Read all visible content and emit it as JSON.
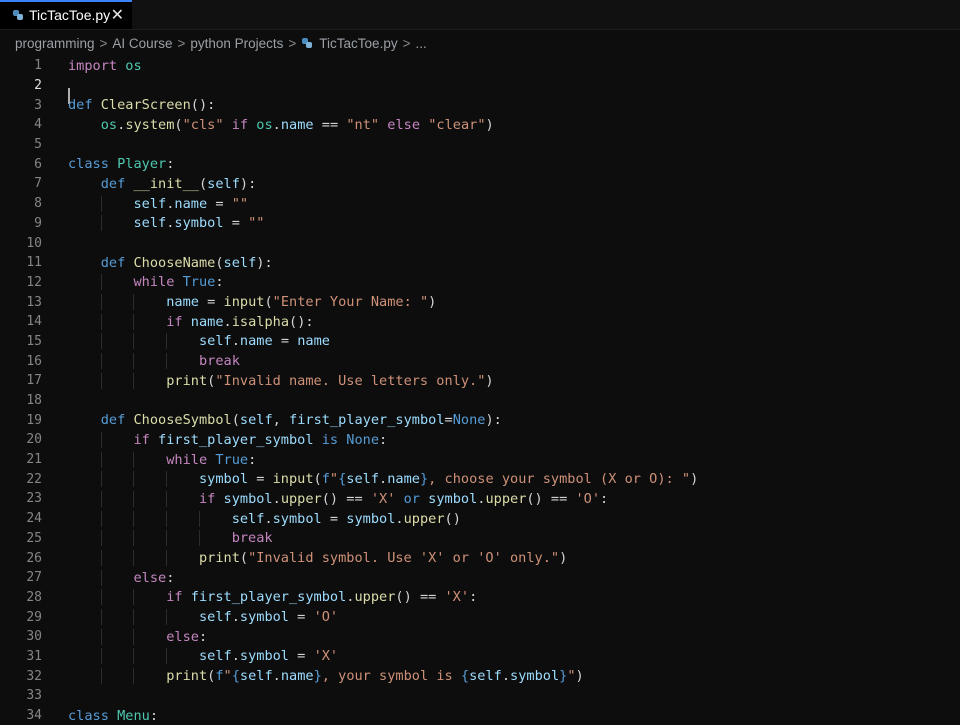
{
  "tab": {
    "filename": "TicTacToe.py",
    "close_label": "✕"
  },
  "breadcrumb": {
    "items": [
      "programming",
      "AI Course",
      "python Projects",
      "TicTacToe.py",
      "..."
    ],
    "separator": ">"
  },
  "editor": {
    "active_line": 2,
    "lines": [
      {
        "n": "1",
        "indent": 0,
        "tokens": [
          [
            "kw",
            "import"
          ],
          [
            "op",
            " "
          ],
          [
            "cls",
            "os"
          ]
        ]
      },
      {
        "n": "2",
        "indent": 0,
        "tokens": []
      },
      {
        "n": "3",
        "indent": 0,
        "tokens": [
          [
            "kwb",
            "def"
          ],
          [
            "op",
            " "
          ],
          [
            "fn",
            "ClearScreen"
          ],
          [
            "op",
            "():"
          ]
        ]
      },
      {
        "n": "4",
        "indent": 1,
        "tokens": [
          [
            "cls",
            "os"
          ],
          [
            "op",
            "."
          ],
          [
            "fn",
            "system"
          ],
          [
            "op",
            "("
          ],
          [
            "str",
            "\"cls\""
          ],
          [
            "op",
            " "
          ],
          [
            "kw",
            "if"
          ],
          [
            "op",
            " "
          ],
          [
            "cls",
            "os"
          ],
          [
            "op",
            "."
          ],
          [
            "var",
            "name"
          ],
          [
            "op",
            " == "
          ],
          [
            "str",
            "\"nt\""
          ],
          [
            "op",
            " "
          ],
          [
            "kw",
            "else"
          ],
          [
            "op",
            " "
          ],
          [
            "str",
            "\"clear\""
          ],
          [
            "op",
            ")"
          ]
        ]
      },
      {
        "n": "5",
        "indent": 0,
        "tokens": []
      },
      {
        "n": "6",
        "indent": 0,
        "tokens": [
          [
            "kwb",
            "class"
          ],
          [
            "op",
            " "
          ],
          [
            "cls",
            "Player"
          ],
          [
            "op",
            ":"
          ]
        ]
      },
      {
        "n": "7",
        "indent": 1,
        "tokens": [
          [
            "kwb",
            "def"
          ],
          [
            "op",
            " "
          ],
          [
            "fn",
            "__init__"
          ],
          [
            "op",
            "("
          ],
          [
            "var",
            "self"
          ],
          [
            "op",
            "):"
          ]
        ]
      },
      {
        "n": "8",
        "indent": 2,
        "tokens": [
          [
            "var",
            "self"
          ],
          [
            "op",
            "."
          ],
          [
            "var",
            "name"
          ],
          [
            "op",
            " = "
          ],
          [
            "str",
            "\"\""
          ]
        ]
      },
      {
        "n": "9",
        "indent": 2,
        "tokens": [
          [
            "var",
            "self"
          ],
          [
            "op",
            "."
          ],
          [
            "var",
            "symbol"
          ],
          [
            "op",
            " = "
          ],
          [
            "str",
            "\"\""
          ]
        ]
      },
      {
        "n": "10",
        "indent": 0,
        "tokens": []
      },
      {
        "n": "11",
        "indent": 1,
        "tokens": [
          [
            "kwb",
            "def"
          ],
          [
            "op",
            " "
          ],
          [
            "fn",
            "ChooseName"
          ],
          [
            "op",
            "("
          ],
          [
            "var",
            "self"
          ],
          [
            "op",
            "):"
          ]
        ]
      },
      {
        "n": "12",
        "indent": 2,
        "tokens": [
          [
            "kw",
            "while"
          ],
          [
            "op",
            " "
          ],
          [
            "kwb",
            "True"
          ],
          [
            "op",
            ":"
          ]
        ]
      },
      {
        "n": "13",
        "indent": 3,
        "tokens": [
          [
            "var",
            "name"
          ],
          [
            "op",
            " = "
          ],
          [
            "fn",
            "input"
          ],
          [
            "op",
            "("
          ],
          [
            "str",
            "\"Enter Your Name: \""
          ],
          [
            "op",
            ")"
          ]
        ]
      },
      {
        "n": "14",
        "indent": 3,
        "tokens": [
          [
            "kw",
            "if"
          ],
          [
            "op",
            " "
          ],
          [
            "var",
            "name"
          ],
          [
            "op",
            "."
          ],
          [
            "fn",
            "isalpha"
          ],
          [
            "op",
            "():"
          ]
        ]
      },
      {
        "n": "15",
        "indent": 4,
        "tokens": [
          [
            "var",
            "self"
          ],
          [
            "op",
            "."
          ],
          [
            "var",
            "name"
          ],
          [
            "op",
            " = "
          ],
          [
            "var",
            "name"
          ]
        ]
      },
      {
        "n": "16",
        "indent": 4,
        "tokens": [
          [
            "kw",
            "break"
          ]
        ]
      },
      {
        "n": "17",
        "indent": 3,
        "tokens": [
          [
            "fn",
            "print"
          ],
          [
            "op",
            "("
          ],
          [
            "str",
            "\"Invalid name. Use letters only.\""
          ],
          [
            "op",
            ")"
          ]
        ]
      },
      {
        "n": "18",
        "indent": 0,
        "tokens": []
      },
      {
        "n": "19",
        "indent": 1,
        "tokens": [
          [
            "kwb",
            "def"
          ],
          [
            "op",
            " "
          ],
          [
            "fn",
            "ChooseSymbol"
          ],
          [
            "op",
            "("
          ],
          [
            "var",
            "self"
          ],
          [
            "op",
            ", "
          ],
          [
            "var",
            "first_player_symbol"
          ],
          [
            "op",
            "="
          ],
          [
            "kwb",
            "None"
          ],
          [
            "op",
            "):"
          ]
        ]
      },
      {
        "n": "20",
        "indent": 2,
        "tokens": [
          [
            "kw",
            "if"
          ],
          [
            "op",
            " "
          ],
          [
            "var",
            "first_player_symbol"
          ],
          [
            "op",
            " "
          ],
          [
            "kwb",
            "is"
          ],
          [
            "op",
            " "
          ],
          [
            "kwb",
            "None"
          ],
          [
            "op",
            ":"
          ]
        ]
      },
      {
        "n": "21",
        "indent": 3,
        "tokens": [
          [
            "kw",
            "while"
          ],
          [
            "op",
            " "
          ],
          [
            "kwb",
            "True"
          ],
          [
            "op",
            ":"
          ]
        ]
      },
      {
        "n": "22",
        "indent": 4,
        "tokens": [
          [
            "var",
            "symbol"
          ],
          [
            "op",
            " = "
          ],
          [
            "fn",
            "input"
          ],
          [
            "op",
            "("
          ],
          [
            "kwb",
            "f"
          ],
          [
            "str",
            "\""
          ],
          [
            "kwb",
            "{"
          ],
          [
            "var",
            "self"
          ],
          [
            "op",
            "."
          ],
          [
            "var",
            "name"
          ],
          [
            "kwb",
            "}"
          ],
          [
            "str",
            ", choose your symbol (X or O): \""
          ],
          [
            "op",
            ")"
          ]
        ]
      },
      {
        "n": "23",
        "indent": 4,
        "tokens": [
          [
            "kw",
            "if"
          ],
          [
            "op",
            " "
          ],
          [
            "var",
            "symbol"
          ],
          [
            "op",
            "."
          ],
          [
            "fn",
            "upper"
          ],
          [
            "op",
            "() == "
          ],
          [
            "str",
            "'X'"
          ],
          [
            "op",
            " "
          ],
          [
            "kwb",
            "or"
          ],
          [
            "op",
            " "
          ],
          [
            "var",
            "symbol"
          ],
          [
            "op",
            "."
          ],
          [
            "fn",
            "upper"
          ],
          [
            "op",
            "() == "
          ],
          [
            "str",
            "'O'"
          ],
          [
            "op",
            ":"
          ]
        ]
      },
      {
        "n": "24",
        "indent": 5,
        "tokens": [
          [
            "var",
            "self"
          ],
          [
            "op",
            "."
          ],
          [
            "var",
            "symbol"
          ],
          [
            "op",
            " = "
          ],
          [
            "var",
            "symbol"
          ],
          [
            "op",
            "."
          ],
          [
            "fn",
            "upper"
          ],
          [
            "op",
            "()"
          ]
        ]
      },
      {
        "n": "25",
        "indent": 5,
        "tokens": [
          [
            "kw",
            "break"
          ]
        ]
      },
      {
        "n": "26",
        "indent": 4,
        "tokens": [
          [
            "fn",
            "print"
          ],
          [
            "op",
            "("
          ],
          [
            "str",
            "\"Invalid symbol. Use 'X' or 'O' only.\""
          ],
          [
            "op",
            ")"
          ]
        ]
      },
      {
        "n": "27",
        "indent": 2,
        "tokens": [
          [
            "kw",
            "else"
          ],
          [
            "op",
            ":"
          ]
        ]
      },
      {
        "n": "28",
        "indent": 3,
        "tokens": [
          [
            "kw",
            "if"
          ],
          [
            "op",
            " "
          ],
          [
            "var",
            "first_player_symbol"
          ],
          [
            "op",
            "."
          ],
          [
            "fn",
            "upper"
          ],
          [
            "op",
            "() == "
          ],
          [
            "str",
            "'X'"
          ],
          [
            "op",
            ":"
          ]
        ]
      },
      {
        "n": "29",
        "indent": 4,
        "tokens": [
          [
            "var",
            "self"
          ],
          [
            "op",
            "."
          ],
          [
            "var",
            "symbol"
          ],
          [
            "op",
            " = "
          ],
          [
            "str",
            "'O'"
          ]
        ]
      },
      {
        "n": "30",
        "indent": 3,
        "tokens": [
          [
            "kw",
            "else"
          ],
          [
            "op",
            ":"
          ]
        ]
      },
      {
        "n": "31",
        "indent": 4,
        "tokens": [
          [
            "var",
            "self"
          ],
          [
            "op",
            "."
          ],
          [
            "var",
            "symbol"
          ],
          [
            "op",
            " = "
          ],
          [
            "str",
            "'X'"
          ]
        ]
      },
      {
        "n": "32",
        "indent": 3,
        "tokens": [
          [
            "fn",
            "print"
          ],
          [
            "op",
            "("
          ],
          [
            "kwb",
            "f"
          ],
          [
            "str",
            "\""
          ],
          [
            "kwb",
            "{"
          ],
          [
            "var",
            "self"
          ],
          [
            "op",
            "."
          ],
          [
            "var",
            "name"
          ],
          [
            "kwb",
            "}"
          ],
          [
            "str",
            ", your symbol is "
          ],
          [
            "kwb",
            "{"
          ],
          [
            "var",
            "self"
          ],
          [
            "op",
            "."
          ],
          [
            "var",
            "symbol"
          ],
          [
            "kwb",
            "}"
          ],
          [
            "str",
            "\""
          ],
          [
            "op",
            ")"
          ]
        ]
      },
      {
        "n": "33",
        "indent": 0,
        "tokens": []
      },
      {
        "n": "34",
        "indent": 0,
        "tokens": [
          [
            "kwb",
            "class"
          ],
          [
            "op",
            " "
          ],
          [
            "cls",
            "Menu"
          ],
          [
            "op",
            ":"
          ]
        ]
      }
    ]
  }
}
